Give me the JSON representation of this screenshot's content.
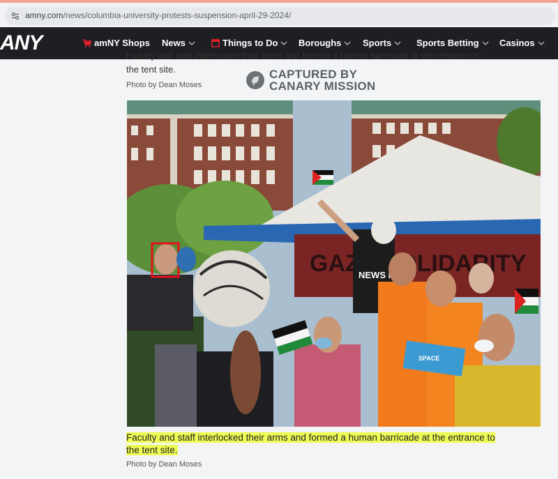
{
  "browser": {
    "url_domain": "amny.com",
    "url_path": "/news/columbia-university-protests-suspension-april-29-2024/"
  },
  "nav": {
    "logo": "ANY",
    "items": [
      {
        "label": "amNY Shops",
        "icon": "cart-icon"
      },
      {
        "label": "News"
      },
      {
        "label": "Things to Do",
        "icon": "calendar-icon"
      },
      {
        "label": "Boroughs"
      },
      {
        "label": "Sports"
      },
      {
        "label": "Sports Betting"
      },
      {
        "label": "Casinos"
      }
    ]
  },
  "article": {
    "prev_caption_tail": "Faculty and staff interlocked their arms and formed a human barricade at the entrance to",
    "prev_caption_end": "the tent site.",
    "prev_credit": "Photo by Dean Moses",
    "watermark_line1": "CAPTURED BY",
    "watermark_line2": "CANARY MISSION",
    "photo_sign_text": "NEWS NOW",
    "photo_banner_text": "GAZA SOLIDARITY",
    "photo_box_label": "SPACE",
    "caption_line1": "Faculty and staff interlocked their arms and formed a human barricade at the entrance to",
    "caption_line2": "the tent site.",
    "credit": "Photo by Dean Moses"
  },
  "colors": {
    "nav_bg": "#1e1f23",
    "highlight": "#eefc54",
    "cart_red": "#e0202a",
    "face_box": "#e4121b"
  }
}
